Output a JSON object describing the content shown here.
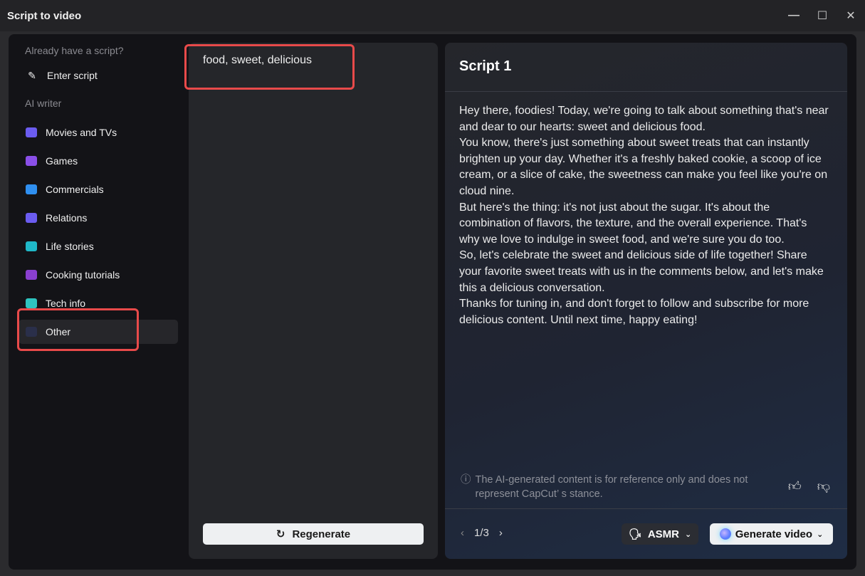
{
  "window": {
    "title": "Script to video",
    "minimize": "—",
    "maximize": "☐",
    "close": "✕"
  },
  "sidebar": {
    "section_existing": "Already have a script?",
    "enter_script": "Enter script",
    "section_ai": "AI writer",
    "items": [
      {
        "label": "Movies and TVs",
        "icon": "clapperboard-icon",
        "color": "#6b5cf0"
      },
      {
        "label": "Games",
        "icon": "gamepad-icon",
        "color": "#8a4fe8"
      },
      {
        "label": "Commercials",
        "icon": "presentation-icon",
        "color": "#2f8ff0"
      },
      {
        "label": "Relations",
        "icon": "people-heart-icon",
        "color": "#6b5cf0"
      },
      {
        "label": "Life stories",
        "icon": "person-wave-icon",
        "color": "#1fb8c8"
      },
      {
        "label": "Cooking tutorials",
        "icon": "wine-glass-icon",
        "color": "#8a3fd0"
      },
      {
        "label": "Tech info",
        "icon": "rocket-icon",
        "color": "#2ec4c0"
      },
      {
        "label": "Other",
        "icon": "note-icon",
        "color": "#2a2f4a",
        "active": true
      }
    ]
  },
  "middle": {
    "keywords": "food, sweet, delicious",
    "regenerate": "Regenerate"
  },
  "script": {
    "title": "Script 1",
    "paragraphs": [
      "Hey there, foodies! Today, we're going to talk about something that's near and dear to our hearts: sweet and delicious food.",
      "You know, there's just something about sweet treats that can instantly brighten up your day. Whether it's a freshly baked cookie, a scoop of ice cream, or a slice of cake, the sweetness can make you feel like you're on cloud nine.",
      "But here's the thing: it's not just about the sugar. It's about the combination of flavors, the texture, and the overall experience. That's why we love to indulge in sweet food, and we're sure you do too.",
      "So, let's celebrate the sweet and delicious side of life together! Share your favorite sweet treats with us in the comments below, and let's make this a delicious conversation.",
      "Thanks for tuning in, and don't forget to follow and subscribe for more delicious content. Until next time, happy eating!"
    ],
    "disclaimer": "The AI-generated content is for reference only and does not represent CapCut’ s stance.",
    "page": "1/3",
    "voice": "ASMR",
    "generate": "Generate video"
  }
}
